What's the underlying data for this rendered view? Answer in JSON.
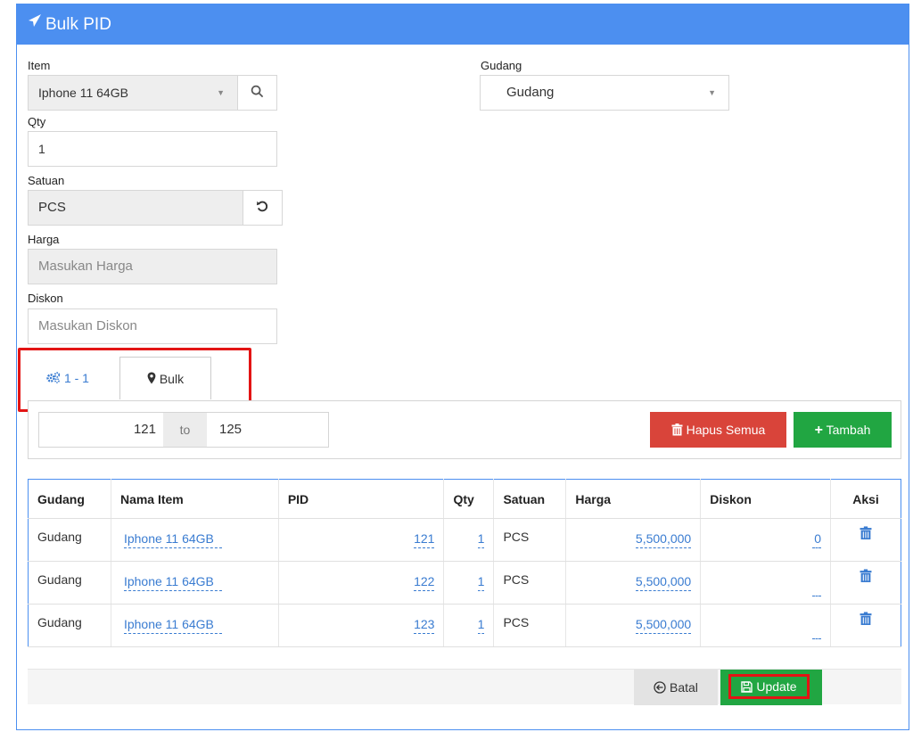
{
  "header": {
    "title": "Bulk PID"
  },
  "form": {
    "item_label": "Item",
    "item_value": "Iphone 11 64GB",
    "gudang_label": "Gudang",
    "gudang_value": "Gudang",
    "qty_label": "Qty",
    "qty_value": "1",
    "satuan_label": "Satuan",
    "satuan_value": "PCS",
    "harga_label": "Harga",
    "harga_placeholder": "Masukan Harga",
    "diskon_label": "Diskon",
    "diskon_placeholder": "Masukan Diskon"
  },
  "tabs": [
    {
      "label": "1 - 1",
      "icon": "gears-icon"
    },
    {
      "label": "Bulk",
      "icon": "map-marker-icon"
    }
  ],
  "range": {
    "from": "121",
    "separator": "to",
    "to": "125"
  },
  "actions": {
    "hapus_label": "Hapus Semua",
    "tambah_label": "Tambah"
  },
  "table": {
    "headers": [
      "Gudang",
      "Nama Item",
      "PID",
      "Qty",
      "Satuan",
      "Harga",
      "Diskon",
      "Aksi"
    ],
    "rows": [
      {
        "gudang": "Gudang",
        "nama": "Iphone 11 64GB",
        "pid": "121",
        "qty": "1",
        "satuan": "PCS",
        "harga": "5,500,000",
        "diskon": "0"
      },
      {
        "gudang": "Gudang",
        "nama": "Iphone 11 64GB",
        "pid": "122",
        "qty": "1",
        "satuan": "PCS",
        "harga": "5,500,000",
        "diskon": ""
      },
      {
        "gudang": "Gudang",
        "nama": "Iphone 11 64GB",
        "pid": "123",
        "qty": "1",
        "satuan": "PCS",
        "harga": "5,500,000",
        "diskon": ""
      }
    ]
  },
  "footer": {
    "batal_label": "Batal",
    "update_label": "Update"
  },
  "colors": {
    "primary": "#4c8ff0",
    "danger": "#d9443a",
    "success": "#21a642",
    "highlight": "#e31414",
    "link": "#3a7cd1"
  }
}
